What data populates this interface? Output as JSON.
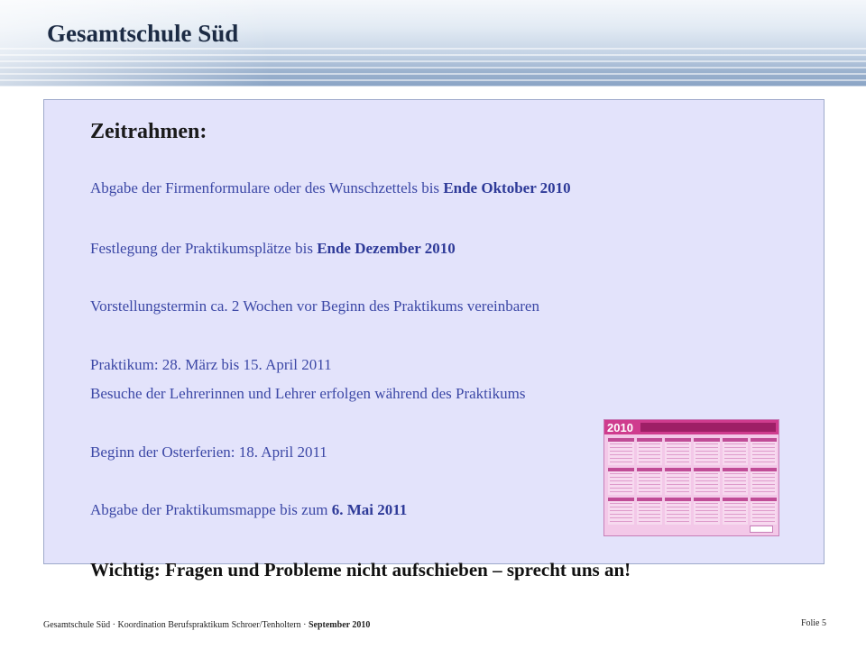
{
  "header": {
    "title": "Gesamtschule Süd"
  },
  "content": {
    "heading": "Zeitrahmen:",
    "line1": {
      "text": "Abgabe der Firmenformulare oder des Wunschzettels bis ",
      "emph": "Ende Oktober 2010"
    },
    "line2": {
      "text": "Festlegung der Praktikumsplätze bis ",
      "emph": "Ende Dezember 2010"
    },
    "line3": "Vorstellungstermin ca. 2 Wochen vor Beginn des Praktikums vereinbaren",
    "line4": "Praktikum: 28. März bis 15. April 2011",
    "line5": "Besuche der Lehrerinnen und Lehrer erfolgen während des Praktikums",
    "line6": "Beginn der Osterferien: 18. April 2011",
    "line7": {
      "text": "Abgabe der Praktikumsmappe bis zum ",
      "emph": "6. Mai 2011"
    },
    "important": "Wichtig: Fragen und Probleme nicht aufschieben – sprecht uns an!"
  },
  "calendar_image": {
    "year": "2010",
    "color": "#cf3c8e"
  },
  "footer": {
    "left_text": "Gesamtschule Süd · Koordination Berufspraktikum Schroer/Tenholtern · ",
    "left_emph": "September 2010",
    "folio": "Folie 5"
  }
}
